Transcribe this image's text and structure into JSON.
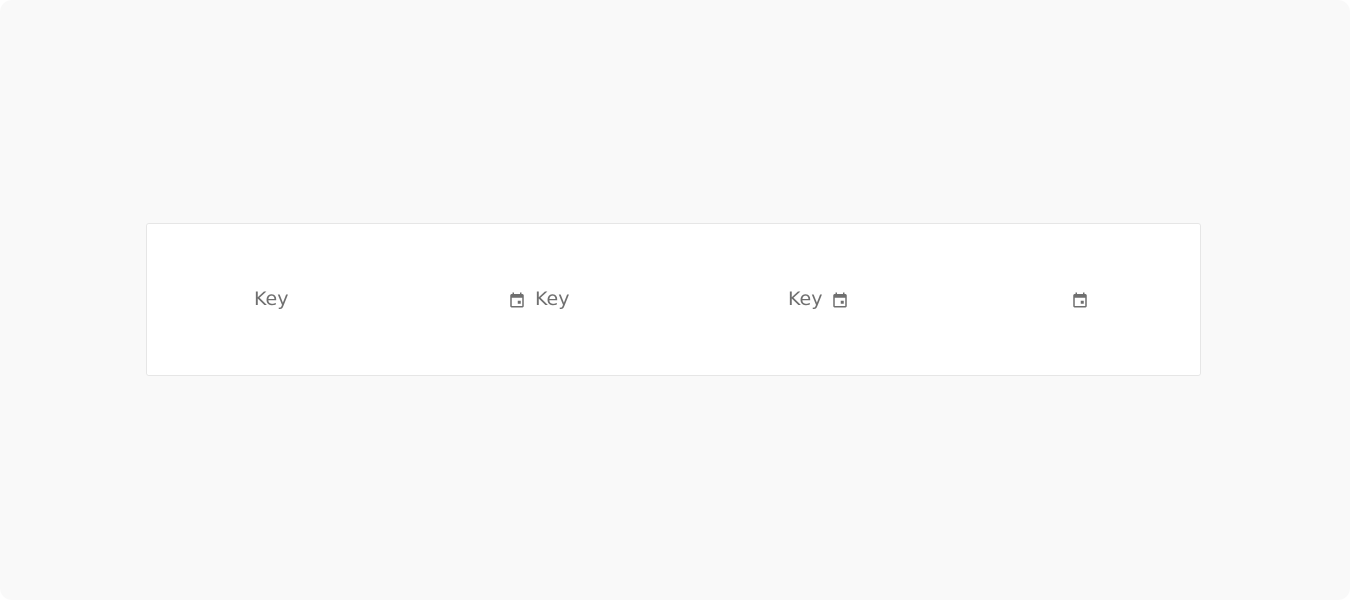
{
  "items": [
    {
      "label": "Key",
      "icon": null
    },
    {
      "label": "Key",
      "icon": "calendar-icon",
      "icon_position": "leading"
    },
    {
      "label": "Key",
      "icon": "calendar-icon",
      "icon_position": "trailing"
    },
    {
      "label": "",
      "icon": "calendar-icon",
      "icon_position": "only"
    }
  ],
  "colors": {
    "page_background": "#f9f9f9",
    "card_background": "#ffffff",
    "card_border": "#e6e6e6",
    "text": "#6f6f6f",
    "icon": "#6f6f6f"
  }
}
